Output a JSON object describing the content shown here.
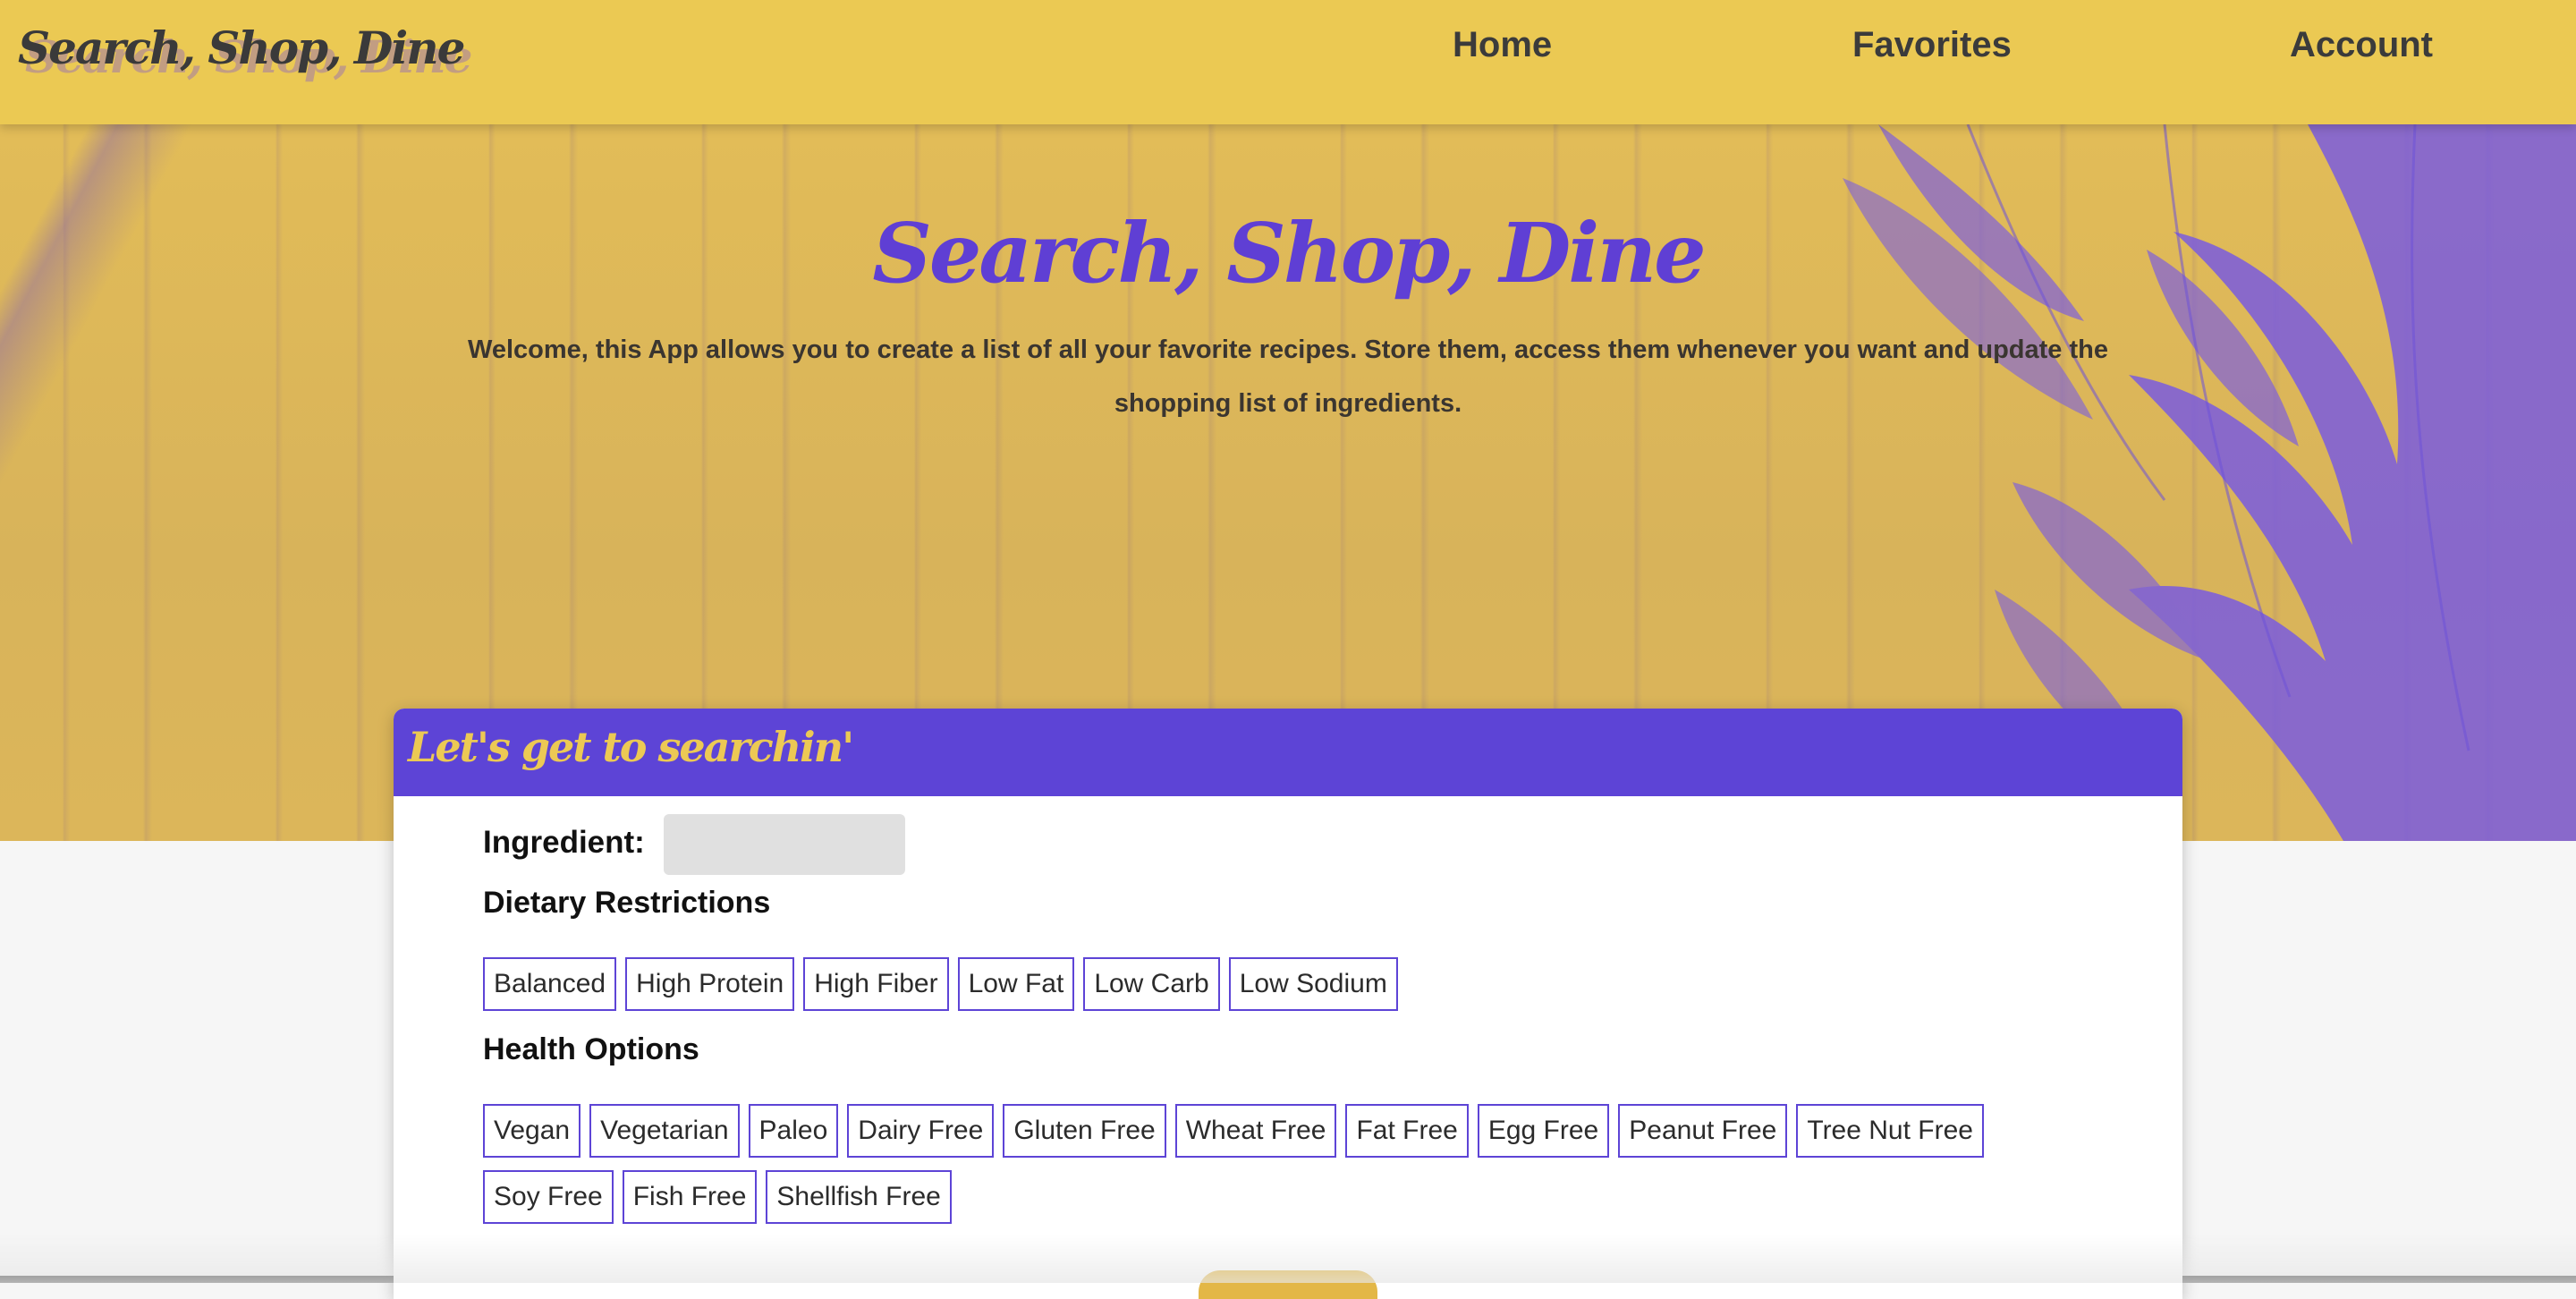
{
  "navbar": {
    "brand": "Search, Shop, Dine",
    "links": {
      "home": "Home",
      "favorites": "Favorites",
      "account": "Account"
    }
  },
  "hero": {
    "title": "Search, Shop, Dine",
    "welcome_text": "Welcome, this App allows you to create a list of all your favorite recipes. Store them, access them whenever you want and update the shopping list of ingredients."
  },
  "search_card": {
    "header": "Let's get to searchin'",
    "ingredient_label": "Ingredient:",
    "ingredient_value": "",
    "dietary_title": "Dietary Restrictions",
    "dietary_options": [
      "Balanced",
      "High Protein",
      "High Fiber",
      "Low Fat",
      "Low Carb",
      "Low Sodium"
    ],
    "health_title": "Health Options",
    "health_options_row1": [
      "Vegan",
      "Vegetarian",
      "Paleo",
      "Dairy Free",
      "Gluten Free",
      "Wheat Free",
      "Fat Free",
      "Egg Free",
      "Peanut Free",
      "Tree Nut Free"
    ],
    "health_options_row2": [
      "Soy Free",
      "Fish Free",
      "Shellfish Free"
    ]
  },
  "colors": {
    "navbar": "#ebc953",
    "accent_purple": "#5d44d6",
    "accent_yellow": "#ecc954",
    "text_dark": "#3b3b3b"
  }
}
